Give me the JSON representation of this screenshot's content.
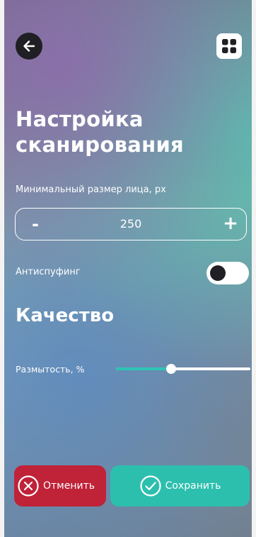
{
  "header": {
    "back_icon": "arrow-left-icon",
    "menu_icon": "grid-icon"
  },
  "page": {
    "title": "Настройка сканирования"
  },
  "face_size": {
    "label": "Минимальный размер лица, px",
    "minus": "-",
    "value": "250",
    "plus": "+"
  },
  "antispoofing": {
    "label": "Антиспуфинг",
    "enabled": false
  },
  "quality": {
    "title": "Качество",
    "blur": {
      "label": "Размытость, %",
      "fraction": 0.41
    }
  },
  "actions": {
    "cancel_label": "Отменить",
    "save_label": "Сохранить"
  },
  "colors": {
    "cancel": "#c02238",
    "save": "#2cbfae",
    "slider_fill": "#2cc4b4",
    "dark": "#1f1f24"
  }
}
